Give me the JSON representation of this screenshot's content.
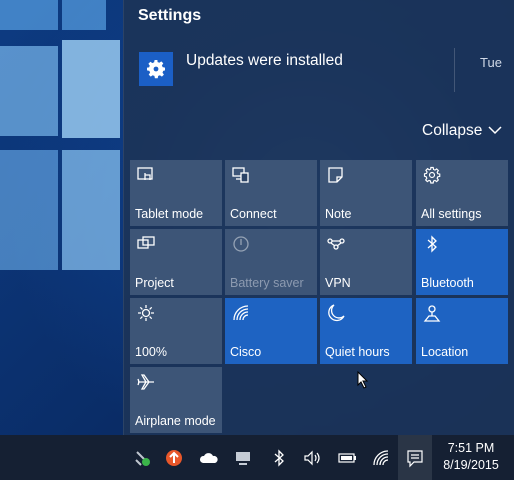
{
  "action_center": {
    "title": "Settings",
    "notification": {
      "text": "Updates were installed",
      "day": "Tue",
      "icon": "gear-icon"
    },
    "collapse_label": "Collapse"
  },
  "tiles": [
    {
      "label": "Tablet mode",
      "icon": "tablet-mode-icon",
      "state": "normal"
    },
    {
      "label": "Connect",
      "icon": "connect-icon",
      "state": "normal"
    },
    {
      "label": "Note",
      "icon": "note-icon",
      "state": "normal"
    },
    {
      "label": "All settings",
      "icon": "gear-icon",
      "state": "normal"
    },
    {
      "label": "Project",
      "icon": "project-icon",
      "state": "normal"
    },
    {
      "label": "Battery saver",
      "icon": "battery-saver-icon",
      "state": "disabled"
    },
    {
      "label": "VPN",
      "icon": "vpn-icon",
      "state": "normal"
    },
    {
      "label": "Bluetooth",
      "icon": "bluetooth-icon",
      "state": "active"
    },
    {
      "label": "100%",
      "icon": "brightness-icon",
      "state": "normal"
    },
    {
      "label": "Cisco",
      "icon": "wifi-icon",
      "state": "active"
    },
    {
      "label": "Quiet hours",
      "icon": "moon-icon",
      "state": "active"
    },
    {
      "label": "Location",
      "icon": "location-icon",
      "state": "active"
    },
    {
      "label": "Airplane mode",
      "icon": "airplane-icon",
      "state": "normal"
    }
  ],
  "taskbar": {
    "time": "7:51 PM",
    "date": "8/19/2015",
    "tray_icons": [
      "network-app-icon",
      "up-arrow-app-icon",
      "onedrive-icon",
      "display-icon",
      "bluetooth-icon",
      "volume-icon",
      "battery-icon",
      "wifi-icon",
      "action-center-icon"
    ]
  },
  "colors": {
    "accent": "#1e63c2",
    "tile": "#3d5577",
    "panel": "#1c3458",
    "taskbar": "#152033"
  }
}
